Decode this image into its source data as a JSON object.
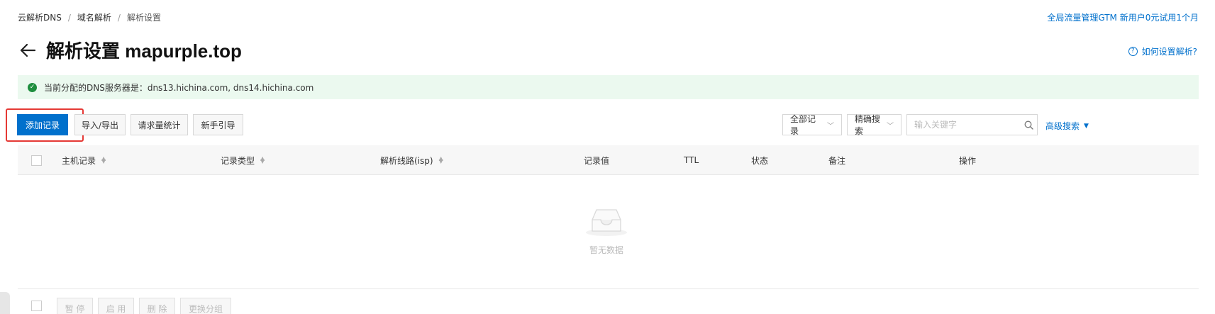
{
  "breadcrumb": {
    "items": [
      "云解析DNS",
      "域名解析",
      "解析设置"
    ],
    "separator": "/"
  },
  "promo_link": "全局流量管理GTM 新用户0元试用1个月",
  "page_title": "解析设置 mapurple.top",
  "help_link": "如何设置解析?",
  "dns_banner": "当前分配的DNS服务器是：dns13.hichina.com, dns14.hichina.com",
  "toolbar": {
    "add_record": "添加记录",
    "import_export": "导入/导出",
    "request_stats": "请求量统计",
    "beginner_guide": "新手引导",
    "filter_all": "全部记录",
    "exact_search": "精确搜索",
    "search_placeholder": "输入关键字",
    "advanced_search": "高级搜索"
  },
  "table": {
    "columns": [
      "主机记录",
      "记录类型",
      "解析线路(isp)",
      "记录值",
      "TTL",
      "状态",
      "备注",
      "操作"
    ],
    "rows": [],
    "empty_text": "暂无数据"
  },
  "footer": {
    "pause": "暂 停",
    "enable": "启 用",
    "delete": "删 除",
    "change_group": "更换分组"
  },
  "colors": {
    "primary": "#0070cc",
    "banner_bg": "#ebf9ef",
    "success": "#1e8e3e",
    "highlight": "#e53935"
  }
}
